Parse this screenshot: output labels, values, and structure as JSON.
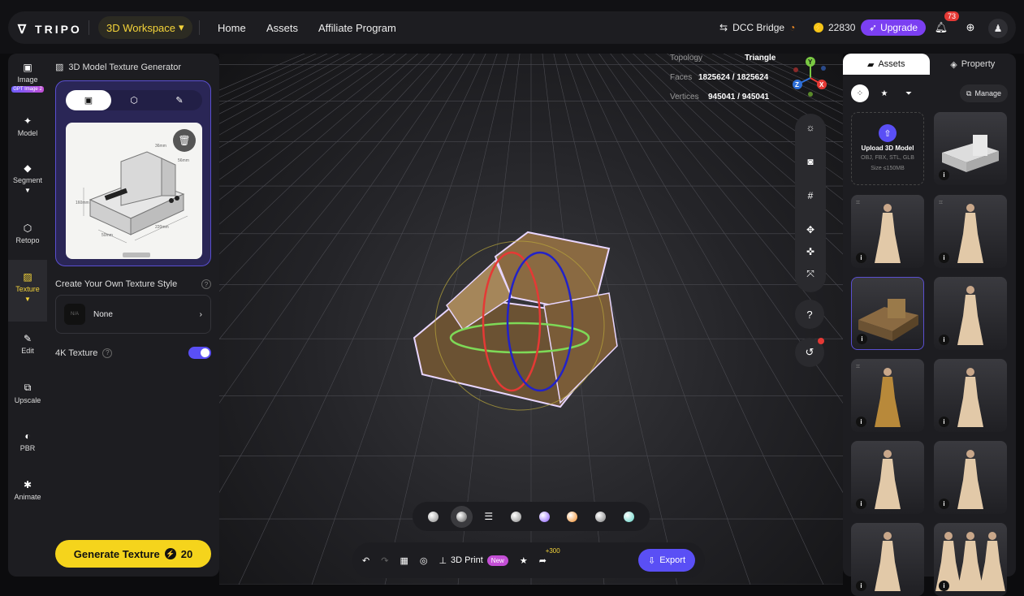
{
  "header": {
    "brand": "TRIPO",
    "workspace": "3D Workspace",
    "nav": [
      "Home",
      "Assets",
      "Affiliate Program"
    ],
    "dcc_bridge": "DCC Bridge",
    "credits": "22830",
    "upgrade": "Upgrade",
    "notifications": "73"
  },
  "rail": [
    {
      "label": "Image",
      "badge": "GPT Image 2",
      "icon": "image-icon"
    },
    {
      "label": "Model",
      "icon": "sparkle-icon"
    },
    {
      "label": "Segment",
      "icon": "cube-icon"
    },
    {
      "label": "Retopo",
      "icon": "mesh-icon"
    },
    {
      "label": "Texture",
      "icon": "texture-icon",
      "active": true
    },
    {
      "label": "Edit",
      "icon": "brush-icon"
    },
    {
      "label": "Upscale",
      "icon": "upscale-icon"
    },
    {
      "label": "PBR",
      "icon": "pbr-icon"
    },
    {
      "label": "Animate",
      "icon": "figure-icon"
    }
  ],
  "panel": {
    "title": "3D Model Texture Generator",
    "style_label": "Create Your Own Texture Style",
    "style_thumb": "N/A",
    "style_value": "None",
    "fourk_label": "4K Texture",
    "generate_label": "Generate Texture",
    "generate_cost": "20",
    "preview_dims": [
      "160mm",
      "220mm",
      "50mm",
      "36mm",
      "56mm"
    ]
  },
  "viewport": {
    "topology_label": "Topology",
    "topology_value": "Triangle",
    "faces_label": "Faces",
    "faces_value": "1825624 / 1825624",
    "vertices_label": "Vertices",
    "vertices_value": "945041 / 945041",
    "axis_labels": [
      "Y",
      "Z",
      "X"
    ],
    "print_label": "3D Print",
    "new_badge": "New",
    "share_bonus": "+300",
    "export_label": "Export",
    "material_colors": [
      "#bdbdbd",
      "#9a9a9a",
      "#8a8a8a",
      "#8a5cff",
      "#f08a24",
      "#7a7a7a",
      "#5ad1c4"
    ]
  },
  "right": {
    "tab_assets": "Assets",
    "tab_property": "Property",
    "manage": "Manage",
    "upload_title": "Upload 3D Model",
    "upload_formats": "OBJ, FBX, STL, GLB",
    "upload_size": "Size ≤150MB"
  }
}
